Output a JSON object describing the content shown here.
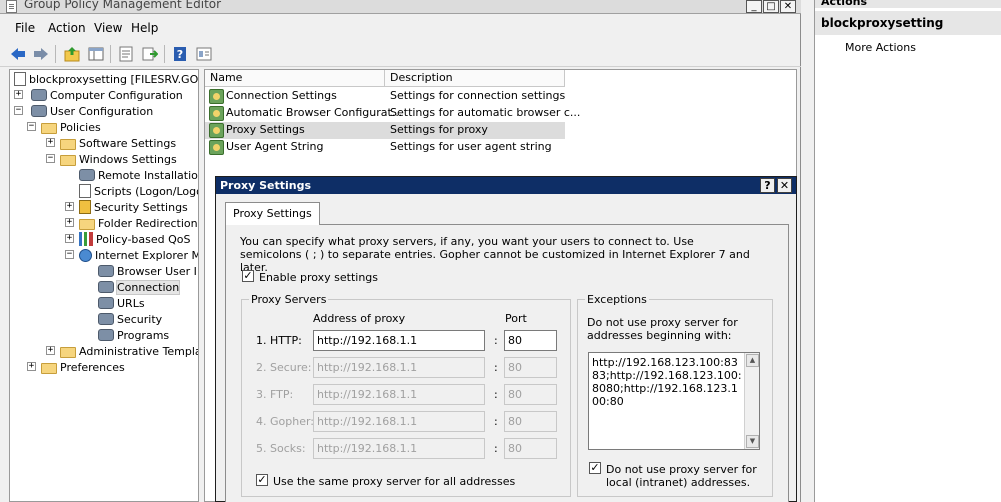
{
  "window": {
    "title": "Group Policy Management Editor",
    "controls": [
      "_",
      "□",
      "✕"
    ]
  },
  "menu": [
    "File",
    "Action",
    "View",
    "Help"
  ],
  "toolbar": {
    "icons": [
      "back-icon",
      "forward-icon",
      "up-folder-icon",
      "show-hide-tree-icon",
      "properties-icon",
      "export-list-icon",
      "help-icon",
      "filter-icon"
    ],
    "colors": {
      "arrow": "#2a68c5",
      "help": "#2a5db0"
    }
  },
  "tree": {
    "items": [
      {
        "label": "blockproxysetting [FILESRV.GOLDE",
        "icon": "gpo-icon",
        "level": 0,
        "expander": ""
      },
      {
        "label": "Computer Configuration",
        "icon": "computer-icon",
        "level": 0,
        "expander": "+"
      },
      {
        "label": "User Configuration",
        "icon": "user-icon",
        "level": 0,
        "expander": "−"
      },
      {
        "label": "Policies",
        "icon": "folder-icon",
        "level": 1,
        "expander": "−"
      },
      {
        "label": "Software Settings",
        "icon": "folder-icon",
        "level": 2,
        "expander": "+"
      },
      {
        "label": "Windows Settings",
        "icon": "folder-icon",
        "level": 2,
        "expander": "−"
      },
      {
        "label": "Remote Installation",
        "icon": "remote-install-icon",
        "level": 3,
        "expander": ""
      },
      {
        "label": "Scripts (Logon/Logo",
        "icon": "script-icon",
        "level": 3,
        "expander": ""
      },
      {
        "label": "Security Settings",
        "icon": "security-icon",
        "level": 3,
        "expander": "+"
      },
      {
        "label": "Folder Redirection",
        "icon": "folder-icon",
        "level": 3,
        "expander": "+"
      },
      {
        "label": "Policy-based QoS",
        "icon": "qos-icon",
        "level": 3,
        "expander": "+"
      },
      {
        "label": "Internet Explorer M",
        "icon": "ie-icon",
        "level": 3,
        "expander": "−"
      },
      {
        "label": "Browser User I",
        "icon": "gear-icon",
        "level": 4,
        "expander": ""
      },
      {
        "label": "Connection",
        "icon": "gear-icon",
        "level": 4,
        "expander": "",
        "selected": true
      },
      {
        "label": "URLs",
        "icon": "gear-icon",
        "level": 4,
        "expander": ""
      },
      {
        "label": "Security",
        "icon": "gear-icon",
        "level": 4,
        "expander": ""
      },
      {
        "label": "Programs",
        "icon": "gear-icon",
        "level": 4,
        "expander": ""
      },
      {
        "label": "Administrative Templat",
        "icon": "folder-icon",
        "level": 2,
        "expander": "+"
      },
      {
        "label": "Preferences",
        "icon": "folder-icon",
        "level": 1,
        "expander": "+"
      }
    ]
  },
  "list": {
    "columns": [
      "Name",
      "Description"
    ],
    "rows": [
      {
        "name": "Connection Settings",
        "description": "Settings for connection settings"
      },
      {
        "name": "Automatic Browser Configurat...",
        "description": "Settings for automatic browser c..."
      },
      {
        "name": "Proxy Settings",
        "description": "Settings for proxy",
        "selected": true
      },
      {
        "name": "User Agent String",
        "description": "Settings for user agent string"
      }
    ]
  },
  "actions": {
    "header": "Actions",
    "section": "blockproxysetting",
    "link": "More Actions"
  },
  "dialog": {
    "title": "Proxy Settings",
    "help": "?",
    "close": "✕",
    "tab": "Proxy Settings",
    "intro": "You can specify what proxy servers, if any, you want your users to connect to. Use semicolons ( ; ) to separate entries. Gopher cannot be customized in Internet Explorer 7 and later.",
    "enable_label": "Enable proxy settings",
    "enable_checked": true,
    "servers": {
      "group_label": "Proxy Servers",
      "address_header": "Address of proxy",
      "port_header": "Port",
      "rows": [
        {
          "label": "1. HTTP:",
          "address": "http://192.168.1.1",
          "port": "80",
          "enabled": true
        },
        {
          "label": "2. Secure:",
          "address": "http://192.168.1.1",
          "port": "80",
          "enabled": false
        },
        {
          "label": "3. FTP:",
          "address": "http://192.168.1.1",
          "port": "80",
          "enabled": false
        },
        {
          "label": "4. Gopher:",
          "address": "http://192.168.1.1",
          "port": "80",
          "enabled": false
        },
        {
          "label": "5. Socks:",
          "address": "http://192.168.1.1",
          "port": "80",
          "enabled": false
        }
      ],
      "same_label": "Use the same proxy server for all addresses",
      "same_checked": true
    },
    "exceptions": {
      "group_label": "Exceptions",
      "desc": "Do not use proxy server for addresses beginning with:",
      "text": "http://192.168.123.100:8383;http://192.168.123.100:8080;http://192.168.123.100:80",
      "local_label": "Do not use proxy server for local (intranet) addresses.",
      "local_checked": true
    }
  }
}
